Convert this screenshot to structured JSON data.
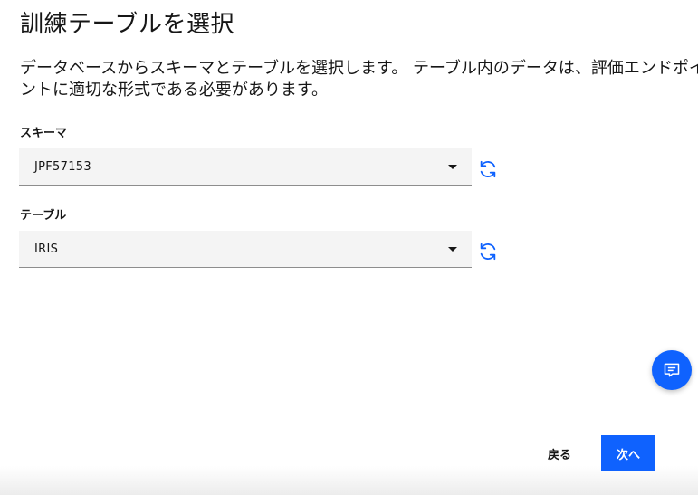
{
  "page": {
    "title": "訓練テーブルを選択",
    "description": "データベースからスキーマとテーブルを選択します。 テーブル内のデータは、評価エンドポイントに適切な形式である必要があります。"
  },
  "schema": {
    "label": "スキーマ",
    "value": "JPF57153",
    "icons": {
      "caret": "chevron-down-icon",
      "refresh": "refresh-icon"
    }
  },
  "table": {
    "label": "テーブル",
    "value": "IRIS",
    "icons": {
      "caret": "chevron-down-icon",
      "refresh": "refresh-icon"
    }
  },
  "chat": {
    "icon": "chat-icon"
  },
  "footer": {
    "back_label": "戻る",
    "next_label": "次へ"
  },
  "colors": {
    "primary": "#0f62fe",
    "field_bg": "#f4f4f4",
    "text": "#161616"
  }
}
